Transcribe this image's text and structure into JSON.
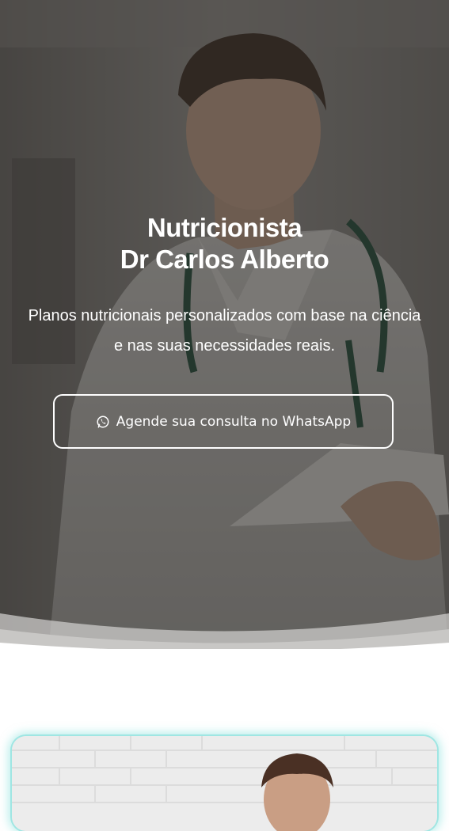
{
  "hero": {
    "title_line1": "Nutricionista",
    "title_line2": "Dr Carlos Alberto",
    "subtitle": "Planos nutricionais personalizados com base na ciência e nas suas necessidades reais.",
    "cta_label": "Agende sua consulta no WhatsApp",
    "cta_icon": "whatsapp-icon",
    "overlay_color": "#2a2826"
  },
  "about": {
    "accent_border_color": "#9fe6e3"
  }
}
